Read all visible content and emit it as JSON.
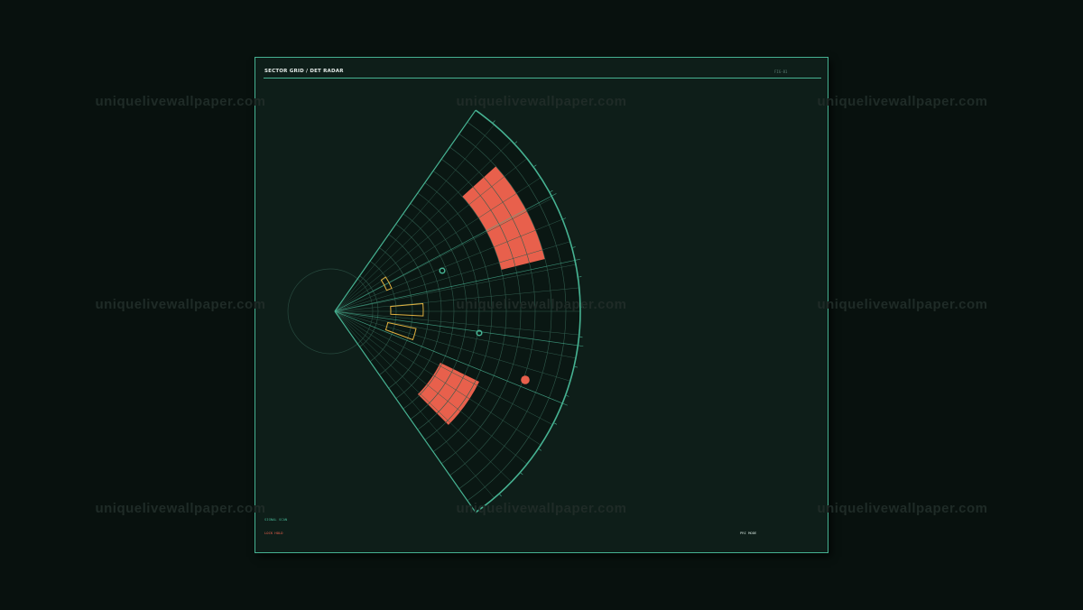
{
  "watermark": "uniquelivewallpaper.com",
  "header": {
    "title": "SECTOR GRID / DET RADAR",
    "code": "FIG-81"
  },
  "legend": {
    "signal": "SIGNAL SCAN",
    "lock": "LOCK HOLD",
    "mode": "PRI MODE"
  },
  "colors": {
    "background": "#08110e",
    "panel": "#0e1e19",
    "accent": "#46b292",
    "alert": "#e8604c",
    "warn": "#e0b040"
  }
}
